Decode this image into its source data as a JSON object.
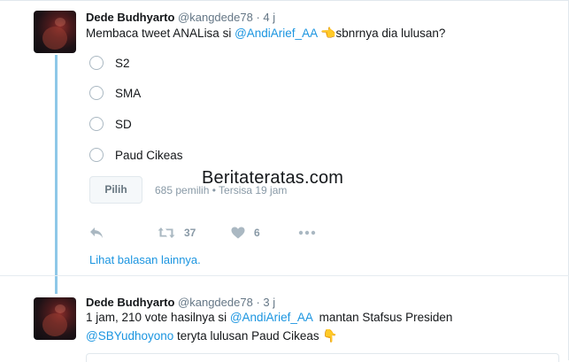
{
  "tweet1": {
    "name": "Dede Budhyarto",
    "handle": "@kangdede78",
    "dot": "·",
    "time": "4 j",
    "text_before": "Membaca tweet ANALisa si ",
    "mention": "@AndiArief_AA",
    "emoji": "👈",
    "text_after": "sbnrnya dia lulusan?",
    "poll": {
      "options": [
        "S2",
        "SMA",
        "SD",
        "Paud Cikeas"
      ],
      "vote_label": "Pilih",
      "meta": "685 pemilih • Tersisa 19 jam"
    },
    "actions": {
      "reply_icon": "reply-icon",
      "retweet_icon": "retweet-icon",
      "retweet_count": "37",
      "like_icon": "heart-icon",
      "like_count": "6",
      "more_icon": "more-icon"
    },
    "more_replies": "Lihat balasan lainnya."
  },
  "watermark": "Beritateratas.com",
  "tweet2": {
    "name": "Dede Budhyarto",
    "handle": "@kangdede78",
    "dot": "·",
    "time": "3 j",
    "line1_before": "1 jam,  210 vote hasilnya si ",
    "line1_mention": "@AndiArief_AA",
    "line1_after": "  mantan Stafsus Presiden",
    "line2_mention": "@SBYudhoyono",
    "line2_after": " teryta lulusan Paud Cikeas",
    "emoji": "👇"
  },
  "colors": {
    "link": "#1b95e0",
    "thread_line": "#8ec8e8",
    "muted": "#657786"
  }
}
